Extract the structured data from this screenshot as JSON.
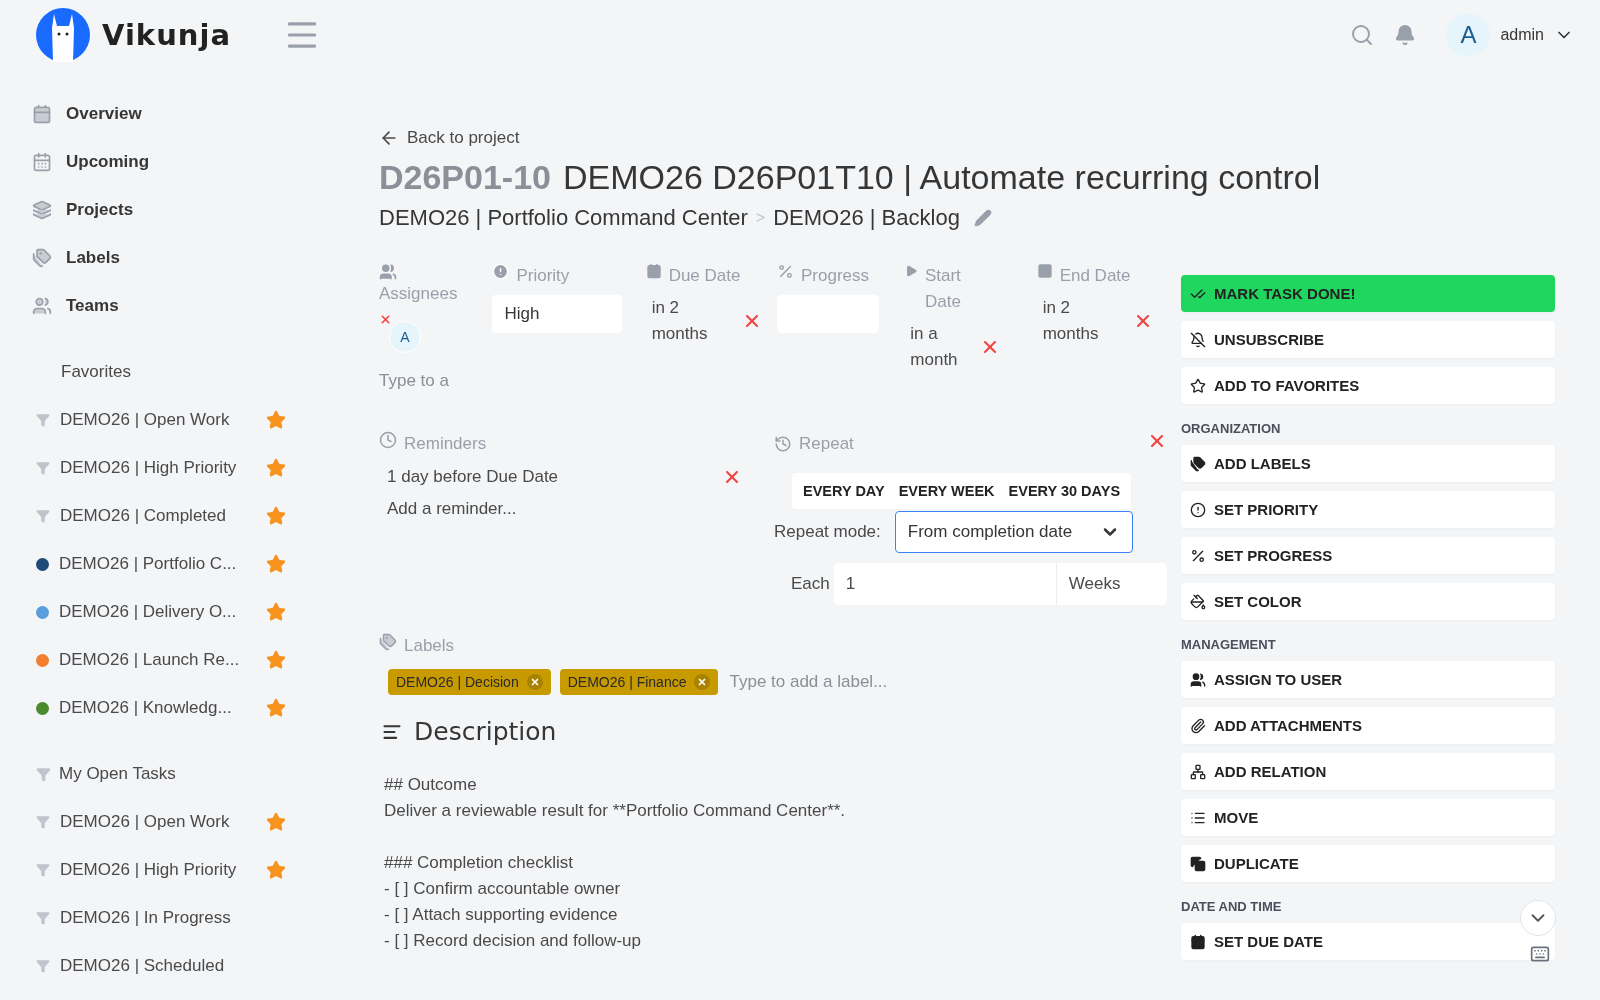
{
  "app": {
    "logo_text": "Vikunja"
  },
  "header": {
    "user_initial": "A",
    "username": "admin"
  },
  "nav": [
    {
      "label": "Overview"
    },
    {
      "label": "Upcoming"
    },
    {
      "label": "Projects"
    },
    {
      "label": "Labels"
    },
    {
      "label": "Teams"
    }
  ],
  "sidebar_sections": [
    {
      "title": "Favorites",
      "kind": "plain",
      "items": [
        {
          "label": "DEMO26 | Open Work",
          "kind": "filter",
          "starred": true
        },
        {
          "label": "DEMO26 | High Priority",
          "kind": "filter",
          "starred": true
        },
        {
          "label": "DEMO26 | Completed",
          "kind": "filter",
          "starred": true
        },
        {
          "label": "DEMO26 | Portfolio C...",
          "kind": "project",
          "color": "#1e4a7a",
          "starred": true
        },
        {
          "label": "DEMO26 | Delivery O...",
          "kind": "project",
          "color": "#5a9fdb",
          "starred": true
        },
        {
          "label": "DEMO26 | Launch Re...",
          "kind": "project",
          "color": "#f07f30",
          "starred": true
        },
        {
          "label": "DEMO26 | Knowledg...",
          "kind": "project",
          "color": "#4b8a2e",
          "starred": true
        }
      ]
    },
    {
      "title": "My Open Tasks",
      "kind": "filter",
      "items": [
        {
          "label": "DEMO26 | Open Work",
          "kind": "filter",
          "starred": true
        },
        {
          "label": "DEMO26 | High Priority",
          "kind": "filter",
          "starred": true
        },
        {
          "label": "DEMO26 | In Progress",
          "kind": "filter",
          "starred": false
        },
        {
          "label": "DEMO26 | Scheduled",
          "kind": "filter",
          "starred": false
        }
      ]
    }
  ],
  "task": {
    "back_link": "Back to project",
    "identifier": "D26P01-10",
    "title": "DEMO26 D26P01T10 | Automate recurring control",
    "breadcrumb": [
      "DEMO26 | Portfolio Command Center",
      "DEMO26 | Backlog"
    ],
    "breadcrumb_separator": ">",
    "attributes": [
      {
        "kind": "assignees",
        "label": "Assignees",
        "users": [
          "A"
        ],
        "placeholder": "Type to a"
      },
      {
        "kind": "select",
        "label": "Priority",
        "value": "High"
      },
      {
        "kind": "date",
        "label": "Due Date",
        "value": "in 2 months"
      },
      {
        "kind": "input",
        "label": "Progress"
      },
      {
        "kind": "date",
        "label": "Start Date",
        "value": "in a month"
      },
      {
        "kind": "date",
        "label": "End Date",
        "value": "in 2 months"
      }
    ],
    "reminders": {
      "label": "Reminders",
      "items": [
        "1 day before Due Date"
      ],
      "add_label": "Add a reminder..."
    },
    "repeat": {
      "label": "Repeat",
      "presets": [
        "EVERY DAY",
        "EVERY WEEK",
        "EVERY 30 DAYS"
      ],
      "mode_label": "Repeat mode:",
      "mode": "From completion date",
      "each_label": "Each",
      "amount": "1",
      "unit": "Weeks"
    },
    "labels": {
      "label": "Labels",
      "items": [
        "DEMO26 | Decision",
        "DEMO26 | Finance"
      ],
      "placeholder": "Type to add a label..."
    },
    "description": {
      "title": "Description",
      "blocks": [
        [
          "## Outcome",
          "Deliver a reviewable result for **Portfolio Command Center**."
        ],
        [
          "### Completion checklist",
          "- [ ] Confirm accountable owner",
          "- [ ] Attach supporting evidence",
          "- [ ] Record decision and follow-up"
        ]
      ]
    }
  },
  "actions": [
    {
      "items": [
        {
          "label": "MARK TASK DONE!",
          "kind": "primary"
        },
        {
          "label": "UNSUBSCRIBE",
          "kind": "plain"
        },
        {
          "label": "ADD TO FAVORITES",
          "kind": "plain"
        }
      ]
    },
    {
      "heading": "ORGANIZATION",
      "items": [
        {
          "label": "ADD LABELS",
          "kind": "plain"
        },
        {
          "label": "SET PRIORITY",
          "kind": "plain"
        },
        {
          "label": "SET PROGRESS",
          "kind": "plain"
        },
        {
          "label": "SET COLOR",
          "kind": "plain"
        }
      ]
    },
    {
      "heading": "MANAGEMENT",
      "items": [
        {
          "label": "ASSIGN TO USER",
          "kind": "plain"
        },
        {
          "label": "ADD ATTACHMENTS",
          "kind": "plain"
        },
        {
          "label": "ADD RELATION",
          "kind": "plain"
        },
        {
          "label": "MOVE",
          "kind": "plain"
        },
        {
          "label": "DUPLICATE",
          "kind": "plain"
        }
      ]
    },
    {
      "heading": "DATE AND TIME",
      "items": [
        {
          "label": "SET DUE DATE",
          "kind": "plain"
        }
      ]
    }
  ]
}
